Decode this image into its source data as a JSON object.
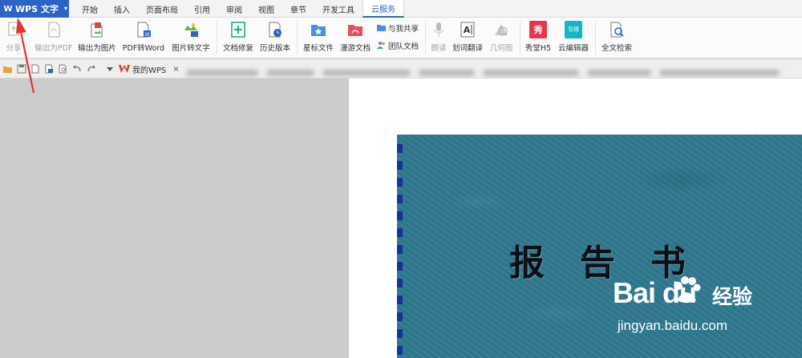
{
  "app": {
    "name": "WPS 文字"
  },
  "menu_tabs": [
    "开始",
    "插入",
    "页面布局",
    "引用",
    "审阅",
    "视图",
    "章节",
    "开发工具",
    "云服务"
  ],
  "active_tab": "云服务",
  "ribbon": {
    "share": "分享",
    "export_pdf": "输出为PDF",
    "export_image": "输出为图片",
    "pdf_to_word": "PDF转Word",
    "image_to_text": "图片转文字",
    "doc_repair": "文档修复",
    "history": "历史版本",
    "starred": "星标文件",
    "roaming": "漫游文档",
    "shared_with_me": "与我共享",
    "team_docs": "团队文档",
    "read_aloud": "朗读",
    "translate": "划词翻译",
    "geometry": "几何图",
    "xiutang": "秀堂H5",
    "cloud_editor": "云编辑器",
    "fulltext_search": "全文检索",
    "xiu_icon_text": "秀",
    "cloud_icon_text": "写得"
  },
  "doc_tab": {
    "label": "我的WPS",
    "close": "×"
  },
  "document": {
    "cover_title": "报告书"
  },
  "watermark": {
    "brand": "Bai du",
    "jingyan": "经验",
    "url": "jingyan.baidu.com"
  },
  "colors": {
    "accent": "#2b63c6",
    "cover": "#2f7890",
    "arrow": "#e0362c"
  }
}
